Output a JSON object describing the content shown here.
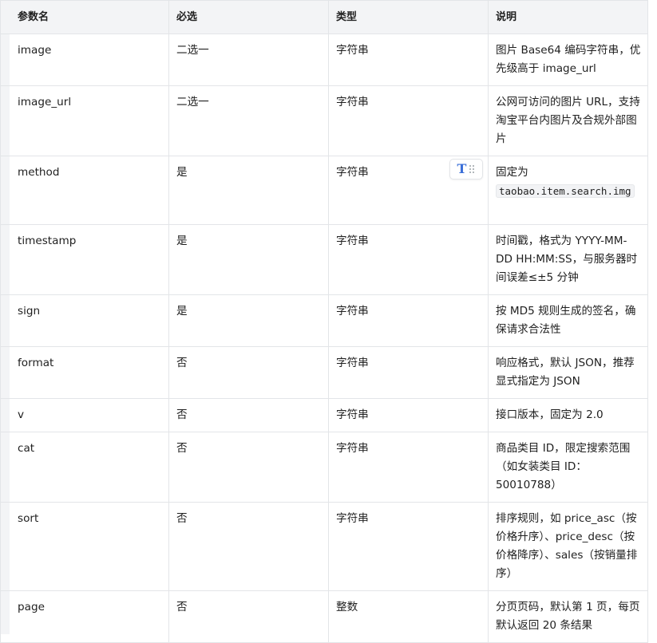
{
  "table": {
    "headers": {
      "name": "参数名",
      "required": "必选",
      "type": "类型",
      "description": "说明"
    },
    "rows": [
      {
        "name": "image",
        "required": "二选一",
        "type": "字符串",
        "description": "图片 Base64 编码字符串，优先级高于 image_url"
      },
      {
        "name": "image_url",
        "required": "二选一",
        "type": "字符串",
        "description": "公网可访问的图片 URL，支持淘宝平台内图片及合规外部图片"
      },
      {
        "name": "method",
        "required": "是",
        "type": "字符串",
        "description_prefix": "固定为",
        "description_code": "taobao.item.search.img"
      },
      {
        "name": "timestamp",
        "required": "是",
        "type": "字符串",
        "description": "时间戳，格式为 YYYY-MM-DD HH:MM:SS，与服务器时间误差≤±5 分钟"
      },
      {
        "name": "sign",
        "required": "是",
        "type": "字符串",
        "description": "按 MD5 规则生成的签名，确保请求合法性"
      },
      {
        "name": "format",
        "required": "否",
        "type": "字符串",
        "description": "响应格式，默认 JSON，推荐显式指定为 JSON"
      },
      {
        "name": "v",
        "required": "否",
        "type": "字符串",
        "description": "接口版本，固定为 2.0"
      },
      {
        "name": "cat",
        "required": "否",
        "type": "字符串",
        "description": "商品类目 ID，限定搜索范围（如女装类目 ID：50010788）"
      },
      {
        "name": "sort",
        "required": "否",
        "type": "字符串",
        "description": "排序规则，如 price_asc（按价格升序）、price_desc（按价格降序）、sales（按销量排序）"
      },
      {
        "name": "page",
        "required": "否",
        "type": "整数",
        "description": "分页页码，默认第 1 页，每页默认返回 20 条结果"
      }
    ]
  },
  "row_tools": {
    "text_icon_glyph": "T",
    "text_icon_name": "text-format-icon",
    "drag_icon_name": "drag-handle-icon"
  },
  "colors": {
    "header_bg": "#f3f4f6",
    "border": "#e3e5e8",
    "accent": "#3b6fd8"
  }
}
